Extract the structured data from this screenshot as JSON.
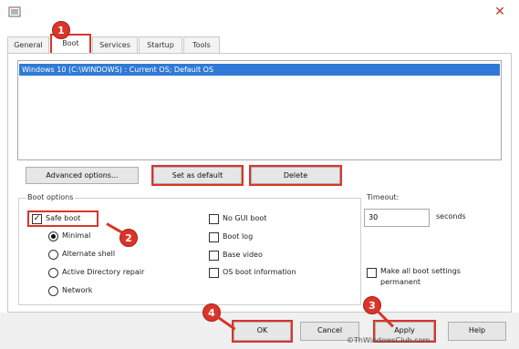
{
  "dialog": {
    "icon": "msconfig-icon",
    "close_glyph": "✕"
  },
  "tabs": [
    {
      "label": "General"
    },
    {
      "label": "Boot"
    },
    {
      "label": "Services"
    },
    {
      "label": "Startup"
    },
    {
      "label": "Tools"
    }
  ],
  "os_list": {
    "entry": "Windows 10 (C:\\WINDOWS) : Current OS; Default OS"
  },
  "buttons": {
    "advanced": "Advanced options...",
    "set_default": "Set as default",
    "delete": "Delete",
    "ok": "OK",
    "cancel": "Cancel",
    "apply": "Apply",
    "help": "Help"
  },
  "boot_options": {
    "legend": "Boot options",
    "safe_boot": {
      "label": "Safe boot",
      "checked": true
    },
    "radios": [
      {
        "label": "Minimal",
        "selected": true
      },
      {
        "label": "Alternate shell",
        "selected": false
      },
      {
        "label": "Active Directory repair",
        "selected": false
      },
      {
        "label": "Network",
        "selected": false
      }
    ],
    "right_checks": [
      {
        "label": "No GUI boot",
        "checked": false
      },
      {
        "label": "Boot log",
        "checked": false
      },
      {
        "label": "Base video",
        "checked": false
      },
      {
        "label": "OS boot information",
        "checked": false
      }
    ]
  },
  "timeout": {
    "legend": "Timeout:",
    "value": "30",
    "unit": "seconds"
  },
  "make_permanent": {
    "label_line1": "Make all boot settings",
    "label_line2": "permanent",
    "checked": false
  },
  "annotations": [
    "1",
    "2",
    "3",
    "4"
  ],
  "accent_color": "#d9352a",
  "selection_color": "#2f7ad6",
  "watermark": "©ThWindowsClub.com"
}
